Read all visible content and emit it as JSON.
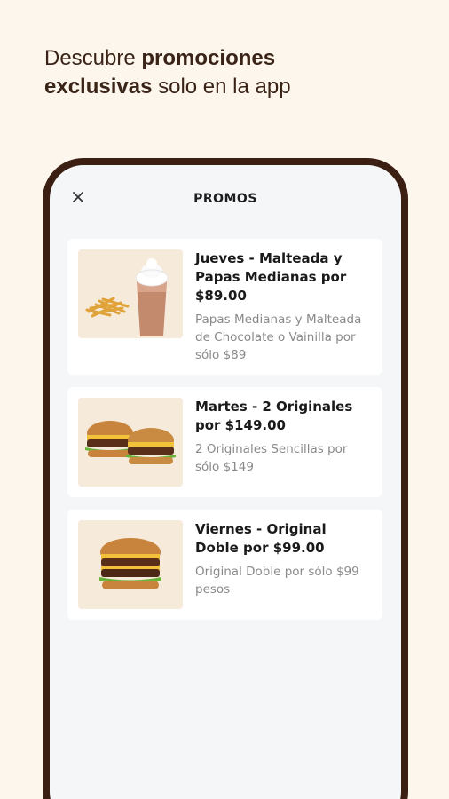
{
  "headline": {
    "part1": "Descubre ",
    "bold1": "promociones",
    "bold2": "exclusivas",
    "part2": " solo en la app"
  },
  "screen": {
    "title": "PROMOS",
    "close_icon": "close-icon"
  },
  "promos": [
    {
      "title": "Jueves - Malteada y Papas Medianas por $89.00",
      "description": "Papas Medianas y Malteada de Chocolate o Vainilla por sólo $89",
      "image": "fries-and-shake"
    },
    {
      "title": "Martes - 2 Originales por $149.00",
      "description": "2 Originales Sencillas por sólo $149",
      "image": "two-burgers"
    },
    {
      "title": "Viernes - Original Doble por $99.00",
      "description": "Original Doble por sólo $99 pesos",
      "image": "double-burger"
    }
  ],
  "colors": {
    "background": "#fdf6ec",
    "phone_frame": "#3b1f12",
    "text_dark": "#3a2418"
  }
}
